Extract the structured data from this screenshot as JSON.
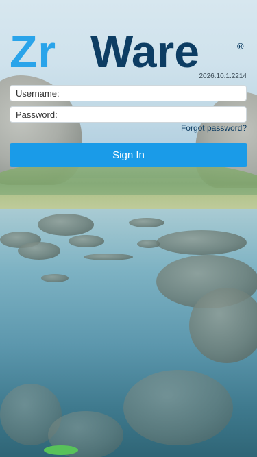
{
  "logo": {
    "part1": "Zr",
    "part2": "Ware",
    "registered": "®"
  },
  "version": "2026.10.1.2214",
  "form": {
    "username_label": "Username:",
    "username_value": "",
    "password_label": "Password:",
    "password_value": "",
    "forgot_password": "Forgot password?",
    "sign_in": "Sign In"
  },
  "colors": {
    "brand_light": "#2aa4ea",
    "brand_dark": "#0d3d63",
    "button": "#1a9be8"
  }
}
